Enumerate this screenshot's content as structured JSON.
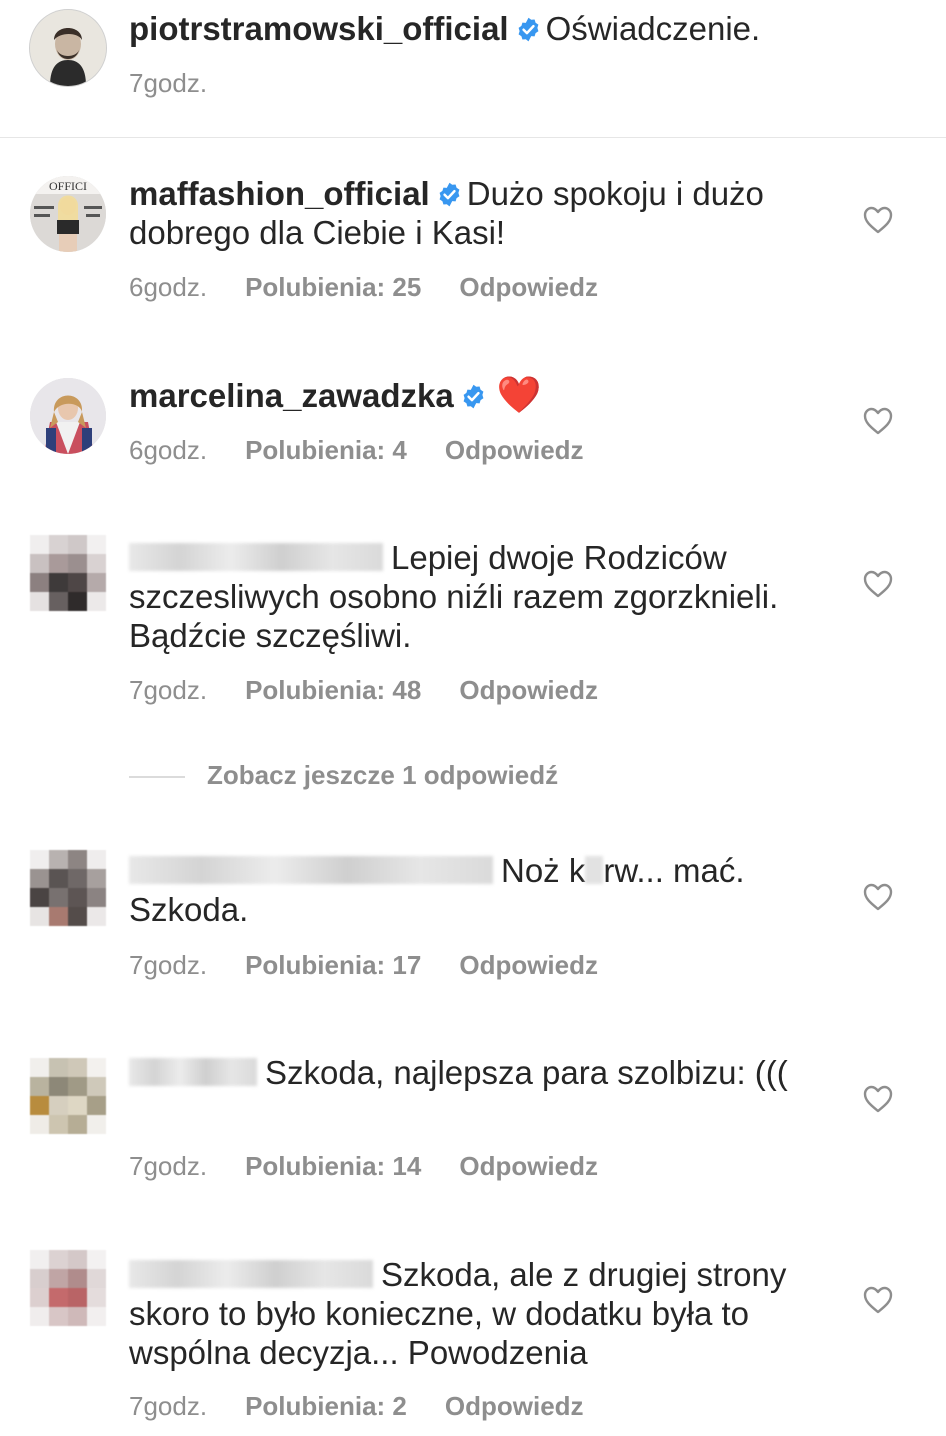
{
  "caption": {
    "username": "piotrstramowski_official",
    "text": "Oświadczenie.",
    "time": "7godz."
  },
  "comments": [
    {
      "username": "maffashion_official",
      "text": "Dużo spokoju i dużo dobrego dla Ciebie i Kasi!",
      "time": "6godz.",
      "likes": "Polubienia: 25",
      "reply": "Odpowiedz"
    },
    {
      "username": "marcelina_zawadzka",
      "text": "❤️",
      "time": "6godz.",
      "likes": "Polubienia: 4",
      "reply": "Odpowiedz"
    },
    {
      "text": "Lepiej dwoje Rodziców szczesliwych osobno niźli razem zgorzknieli. Bądźcie szczęśliwi.",
      "time": "7godz.",
      "likes": "Polubienia: 48",
      "reply": "Odpowiedz"
    },
    {
      "text_a": "Noż k",
      "text_b": "rw... mać. Szkoda.",
      "time": "7godz.",
      "likes": "Polubienia: 17",
      "reply": "Odpowiedz"
    },
    {
      "text": "Szkoda, najlepsza para szolbizu: (((",
      "time": "7godz.",
      "likes": "Polubienia: 14",
      "reply": "Odpowiedz"
    },
    {
      "text": "Szkoda, ale z drugiej strony skoro to było konieczne, w dodatku była to wspólna decyzja... Powodzenia",
      "time": "7godz.",
      "likes": "Polubienia: 2",
      "reply": "Odpowiedz"
    }
  ],
  "more_replies": "Zobacz jeszcze 1 odpowiedź",
  "icons": {
    "verified": "verified-badge-icon",
    "like": "heart-outline-icon"
  },
  "colors": {
    "verified_blue": "#3897f0",
    "secondary_text": "#8e8e8e",
    "primary_text": "#262626"
  }
}
